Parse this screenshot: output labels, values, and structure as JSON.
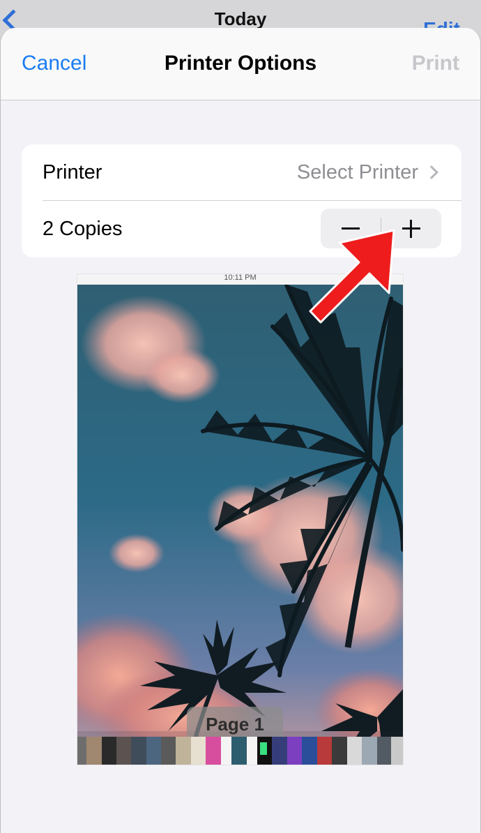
{
  "background_screen": {
    "title": "Today",
    "right_action": "Edit"
  },
  "nav": {
    "cancel_label": "Cancel",
    "title": "Printer Options",
    "print_label": "Print"
  },
  "options": {
    "printer_label": "Printer",
    "printer_value": "Select Printer",
    "copies_label": "2 Copies",
    "decrement_icon": "minus-icon",
    "increment_icon": "plus-icon"
  },
  "preview": {
    "status_time": "10:11 PM",
    "page_label": "Page 1"
  },
  "annotation": {
    "arrow_color": "#ee1c1c",
    "points_to": "increment-button"
  },
  "colors": {
    "accent": "#1a7cf0",
    "disabled": "#c7c7cc",
    "secondary_text": "#8e8e93",
    "sheet_background": "#f2f2f7"
  }
}
